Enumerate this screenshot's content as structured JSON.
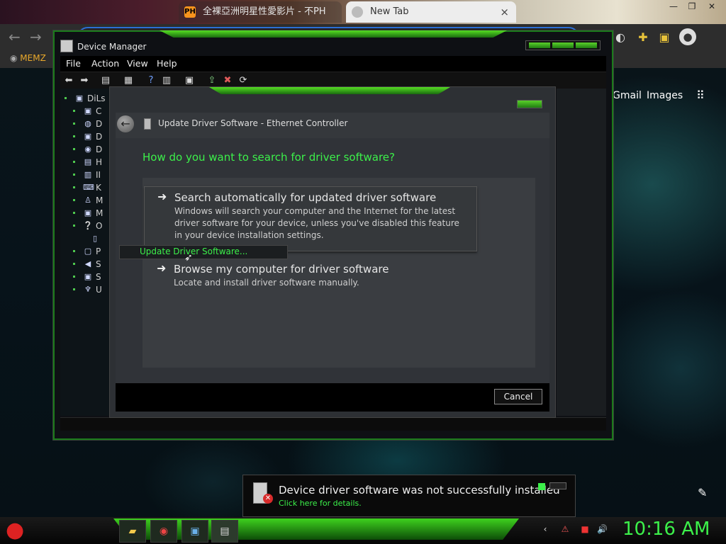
{
  "browser": {
    "tabs": [
      {
        "label": "全裸亞洲明星性愛影片 - 不PH",
        "icon": "PH"
      },
      {
        "label": "New Tab",
        "close": "×"
      }
    ],
    "bookmark": "MEMZ",
    "links": {
      "gmail": "Gmail",
      "images": "Images"
    }
  },
  "device_manager": {
    "title": "Device Manager",
    "menu": [
      "File",
      "Action",
      "View",
      "Help"
    ],
    "tree": {
      "root": "DiLs",
      "items": [
        "C",
        "D",
        "D",
        "D",
        "H",
        "II",
        "K",
        "M",
        "M",
        "O",
        "",
        "P",
        "S",
        "S",
        "U"
      ]
    }
  },
  "wizard": {
    "title": "Update Driver Software - Ethernet Controller",
    "question": "How do you want to search for driver software?",
    "option_auto": {
      "title": "Search automatically for updated driver software",
      "description": "Windows will search your computer and the Internet for the latest driver software for your device, unless you've disabled this feature in your device installation settings."
    },
    "option_browse": {
      "title": "Browse my computer for driver software",
      "description": "Locate and install driver software manually."
    },
    "cancel_label": "Cancel"
  },
  "context_menu": {
    "item": "Update Driver Software..."
  },
  "notification": {
    "title": "Device driver software was not successfully installed",
    "link": "Click here for details."
  },
  "taskbar": {
    "clock": "10:16 AM"
  },
  "colors": {
    "accent_green": "#3cf04a",
    "error_red": "#d82b2b"
  }
}
